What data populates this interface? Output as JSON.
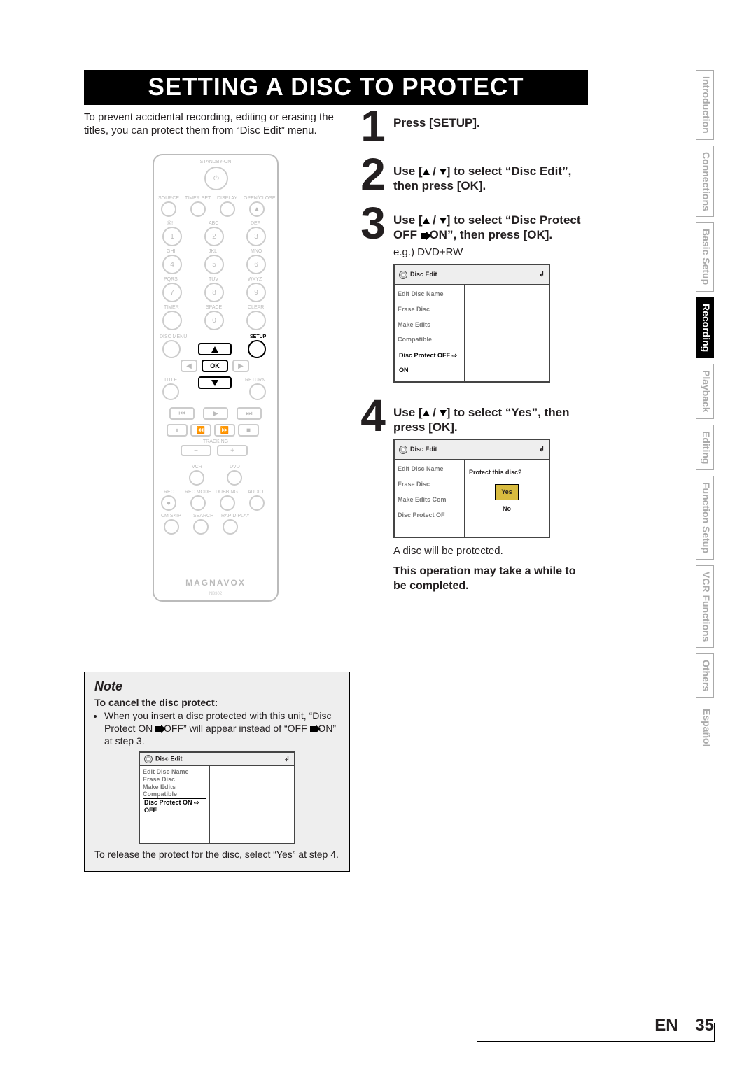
{
  "title": "SETTING A DISC TO PROTECT",
  "intro": "To prevent accidental recording, editing or erasing the titles, you can protect them from “Disc Edit” menu.",
  "side_tabs": [
    {
      "label": "Introduction",
      "active": false
    },
    {
      "label": "Connections",
      "active": false
    },
    {
      "label": "Basic Setup",
      "active": false
    },
    {
      "label": "Recording",
      "active": true
    },
    {
      "label": "Playback",
      "active": false
    },
    {
      "label": "Editing",
      "active": false
    },
    {
      "label": "Function Setup",
      "active": false
    },
    {
      "label": "VCR Functions",
      "active": false
    },
    {
      "label": "Others",
      "active": false
    },
    {
      "label": "Español",
      "active": false,
      "noborder": true
    }
  ],
  "steps": {
    "s1": {
      "num": "1",
      "text": "Press [SETUP]."
    },
    "s2": {
      "num": "2",
      "text": "Use [▲ / ▼] to select “Disc Edit”, then press [OK]."
    },
    "s3": {
      "num": "3",
      "text": "Use [▲ / ▼] to select “Disc Protect OFF ➔ ON”, then press [OK].",
      "sub": "e.g.) DVD+RW"
    },
    "s4": {
      "num": "4",
      "text": "Use [▲ / ▼] to select “Yes”, then press [OK].",
      "after": "A disc will be protected.",
      "bold": "This operation may take a while to be completed."
    }
  },
  "osd": {
    "header": "Disc Edit",
    "items": {
      "edit": "Edit Disc Name",
      "erase": "Erase Disc",
      "compat": "Make Edits Compatible",
      "offon": "Disc Protect OFF ⇨ ON",
      "onoff": "Disc Protect ON ⇨ OFF"
    },
    "question": "Protect this disc?",
    "yes": "Yes",
    "no": "No"
  },
  "remote": {
    "standby": "STANDBY-ON",
    "row1": [
      "SOURCE",
      "TIMER SET",
      "DISPLAY",
      "OPEN/CLOSE"
    ],
    "alpha": [
      "@!",
      "ABC",
      "DEF",
      "GHI",
      "JKL",
      "MNO",
      "PQRS",
      "TUV",
      "WXYZ",
      "TIMER",
      "SPACE",
      "CLEAR"
    ],
    "nums": [
      "1",
      "2",
      "3",
      "4",
      "5",
      "6",
      "7",
      "8",
      "9",
      "0"
    ],
    "disc_menu": "DISC MENU",
    "setup": "SETUP",
    "ok": "OK",
    "title": "TITLE",
    "return": "RETURN",
    "tracking": "TRACKING",
    "vcr": "VCR",
    "dvd": "DVD",
    "row_rec": [
      "REC",
      "REC MODE",
      "DUBBING",
      "AUDIO"
    ],
    "row_cm": [
      "CM SKIP",
      "SEARCH",
      "RAPID PLAY"
    ],
    "logo": "MAGNAVOX",
    "model": "NB302"
  },
  "note": {
    "heading": "Note",
    "sub": "To cancel the disc protect:",
    "bullet": "When you insert a disc protected with this unit, “Disc Protect ON ➔ OFF” will appear instead of “OFF ➔ ON” at step 3.",
    "last": "To release the protect for the disc, select “Yes” at step 4."
  },
  "footer": {
    "lang": "EN",
    "page": "35"
  }
}
